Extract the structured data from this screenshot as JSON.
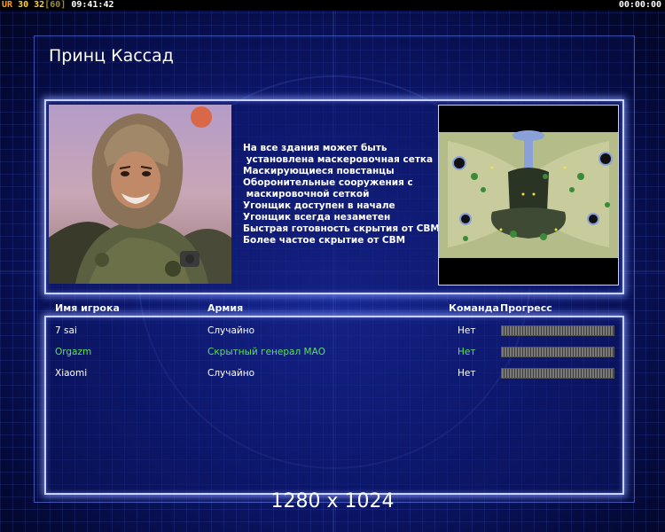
{
  "topbar": {
    "ur": "UR",
    "ping": "30",
    "fps": "32",
    "fps_cap": "[60]",
    "clock": "09:41:42",
    "game_timer": "00:00:00"
  },
  "title": "Принц Кассад",
  "features": [
    "На все здания может быть",
    " установлена маскеровочная сетка",
    "Маскирующиеся повстанцы",
    "Оборонительные сооружения с",
    " маскировочной сеткой",
    "Угонщик доступен в начале",
    "Угонщик всегда незаметен",
    "Быстрая готовность скрытия от СВМ",
    "Более частое скрытие от СВМ"
  ],
  "table": {
    "headers": {
      "player": "Имя игрока",
      "army": "Армия",
      "team": "Команда",
      "progress": "Прогресс"
    },
    "rows": [
      {
        "name": "7 sai",
        "army": "Случайно",
        "team": "Нет",
        "progress": 1.0,
        "highlight": false
      },
      {
        "name": "Orgazm",
        "army": "Скрытный генерал МАО",
        "team": "Нет",
        "progress": 1.0,
        "highlight": true
      },
      {
        "name": "Xiaomi",
        "army": "Случайно",
        "team": "Нет",
        "progress": 1.0,
        "highlight": false
      }
    ]
  },
  "resolution": "1280 x 1024",
  "colors": {
    "highlight_player": "#5ee05e",
    "panel_border": "#c8d2ff"
  }
}
